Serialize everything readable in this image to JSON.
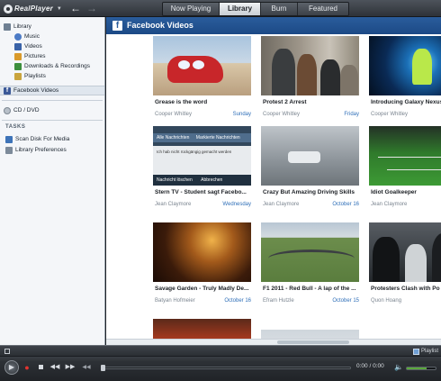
{
  "app": {
    "logo_text": "RealPlayer",
    "logo_caret": "▼"
  },
  "nav": {
    "back": "←",
    "forward": "→"
  },
  "tabs": [
    {
      "label": "Now Playing",
      "active": false
    },
    {
      "label": "Library",
      "active": true
    },
    {
      "label": "Burn",
      "active": false
    },
    {
      "label": "Featured",
      "active": false
    }
  ],
  "sidebar": {
    "library": "Library",
    "items": [
      {
        "label": "Music",
        "icon": "music-icon"
      },
      {
        "label": "Videos",
        "icon": "video-icon"
      },
      {
        "label": "Pictures",
        "icon": "pictures-icon"
      },
      {
        "label": "Downloads & Recordings",
        "icon": "downloads-icon"
      },
      {
        "label": "Playlists",
        "icon": "playlists-icon"
      }
    ],
    "facebook": "Facebook Videos",
    "cd_dvd": "CD / DVD",
    "tasks_heading": "TASKS",
    "tasks": [
      {
        "label": "Scan Disk For Media",
        "icon": "scan-icon"
      },
      {
        "label": "Library Preferences",
        "icon": "preferences-icon"
      }
    ]
  },
  "content": {
    "badge": "f",
    "title": "Facebook Videos",
    "videos": [
      {
        "title": "Grease is the word",
        "author": "Cooper Whitley",
        "date": "Sunday"
      },
      {
        "title": "Protest 2 Arrest",
        "author": "Cooper Whitley",
        "date": "Friday"
      },
      {
        "title": "Introducing Galaxy Nexus",
        "author": "Cooper Whitley",
        "date": ""
      },
      {
        "title": "Stern TV - Student sagt Facebo...",
        "author": "Jean Claymore",
        "date": "Wednesday"
      },
      {
        "title": "Crazy But Amazing Driving Skills",
        "author": "Jean Claymore",
        "date": "October 16"
      },
      {
        "title": "Idiot Goalkeeper",
        "author": "Jean Claymore",
        "date": ""
      },
      {
        "title": "Savage Garden - Truly Madly De...",
        "author": "Batyan Hofmeier",
        "date": "October 16"
      },
      {
        "title": "F1 2011 - Red Bull - A lap of the ...",
        "author": "Efram Hutzle",
        "date": "October 15"
      },
      {
        "title": "Protesters Clash with Po",
        "author": "Quon Hoang",
        "date": ""
      }
    ],
    "stern_overlay": {
      "tab1": "Alle Nachrichten",
      "tab2": "Markierte Nachrichten",
      "line": "Ich hab nicht rückgängig gemacht werden",
      "btn1": "Nachricht löschen",
      "btn2": "Abbrechen"
    }
  },
  "player": {
    "playlist_label": "Playlist",
    "play": "▶",
    "record": "●",
    "prev": "◀◀",
    "next": "▶▶",
    "rewind": "◀◀",
    "time": "0:00 / 0:00",
    "volume_icon": "🔈",
    "progress": 0.0,
    "volume": 0.7
  }
}
